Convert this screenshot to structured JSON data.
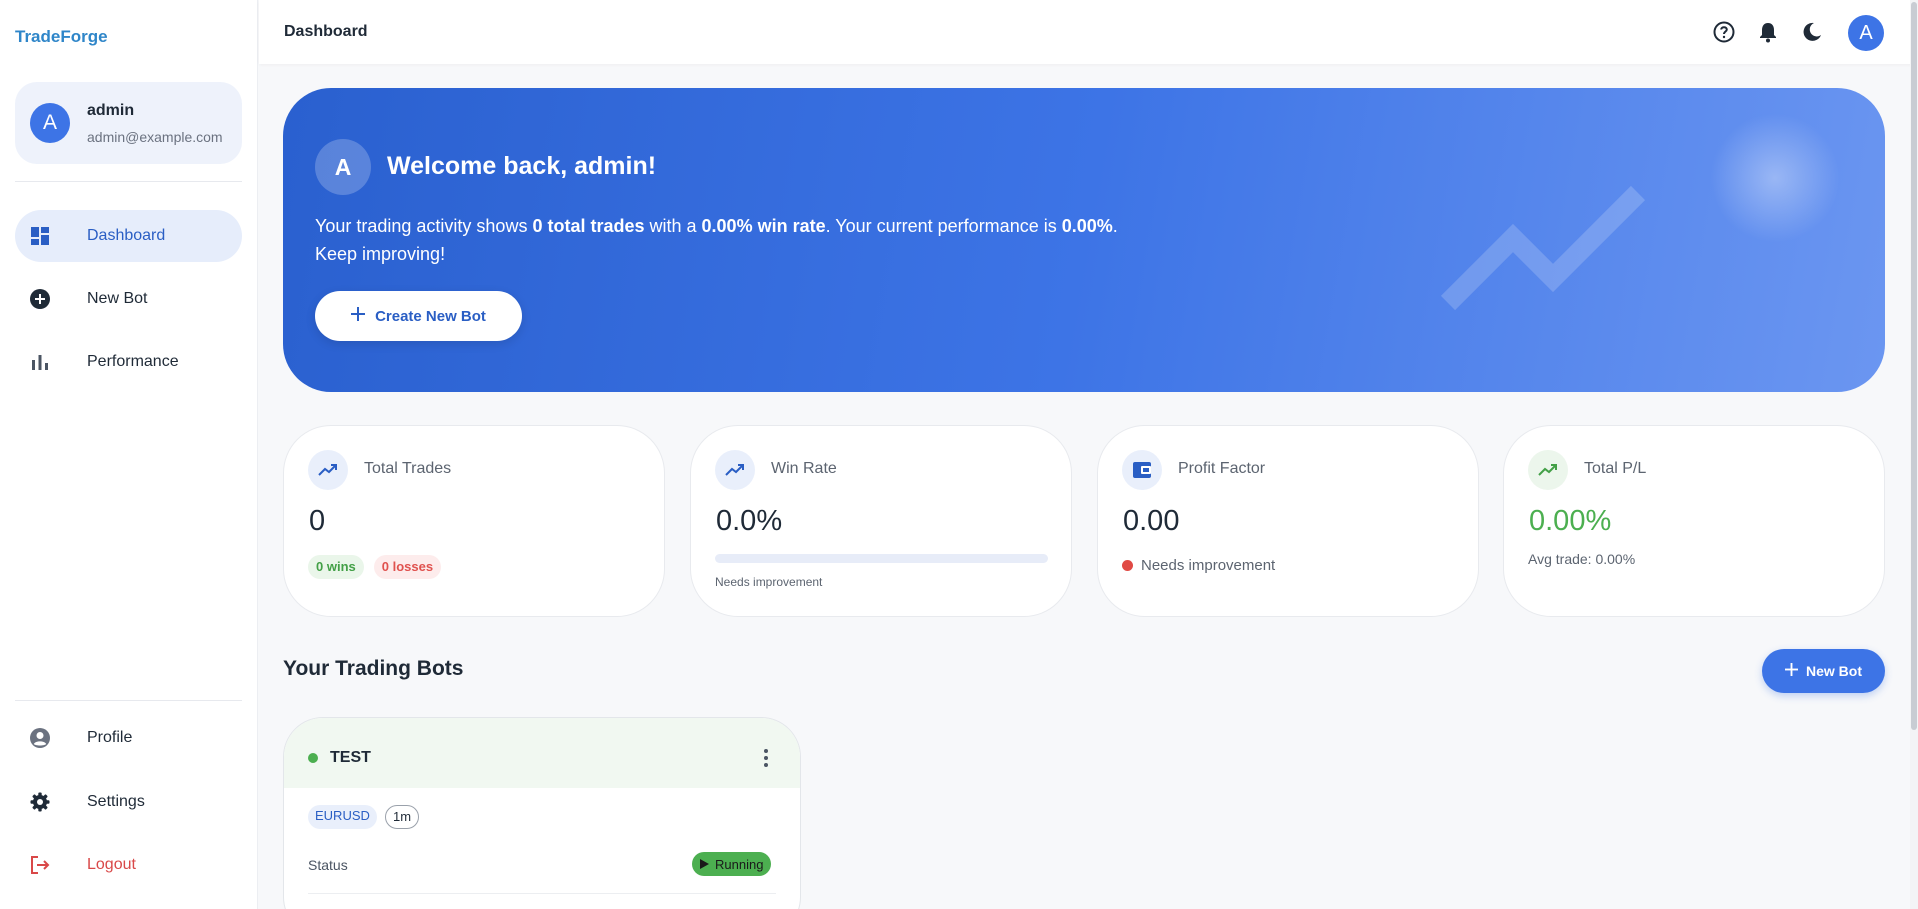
{
  "app": {
    "brand": "TradeForge"
  },
  "user": {
    "initial": "A",
    "name": "admin",
    "email": "admin@example.com"
  },
  "sidebar": {
    "items": [
      {
        "label": "Dashboard",
        "icon": "dashboard-icon",
        "active": true
      },
      {
        "label": "New Bot",
        "icon": "add-circle-icon"
      },
      {
        "label": "Performance",
        "icon": "bar-chart-icon"
      }
    ],
    "bottom": [
      {
        "label": "Profile",
        "icon": "user-circle-icon"
      },
      {
        "label": "Settings",
        "icon": "gear-icon"
      },
      {
        "label": "Logout",
        "icon": "logout-icon"
      }
    ]
  },
  "header": {
    "title": "Dashboard",
    "icons": [
      "help-icon",
      "bell-icon",
      "moon-icon"
    ],
    "avatar_initial": "A"
  },
  "hero": {
    "avatar_initial": "A",
    "title": "Welcome back, admin!",
    "line_prefix": "Your trading activity shows ",
    "total_trades_text": "0 total trades",
    "line_mid": " with a ",
    "win_rate_text": "0.00% win rate",
    "line_mid2": ". Your current performance is ",
    "performance_text": "0.00%",
    "line_suffix": ".",
    "line2": "Keep improving!",
    "button_label": "Create New Bot"
  },
  "stats": {
    "total_trades": {
      "label": "Total Trades",
      "value": "0",
      "wins": "0 wins",
      "losses": "0 losses"
    },
    "win_rate": {
      "label": "Win Rate",
      "value": "0.0%",
      "progress": 0,
      "note": "Needs improvement"
    },
    "profit_factor": {
      "label": "Profit Factor",
      "value": "0.00",
      "note": "Needs improvement"
    },
    "total_pl": {
      "label": "Total P/L",
      "value": "0.00%",
      "note": "Avg trade: 0.00%"
    }
  },
  "bots_section": {
    "title": "Your Trading Bots",
    "new_bot_label": "New Bot",
    "bots": [
      {
        "name": "TEST",
        "pair": "EURUSD",
        "timeframe": "1m",
        "status_label": "Status",
        "status": "Running"
      }
    ]
  },
  "colors": {
    "accent": "#3d74e6",
    "brand": "#2f86c9",
    "positive": "#4caf50",
    "negative": "#e04a44"
  }
}
